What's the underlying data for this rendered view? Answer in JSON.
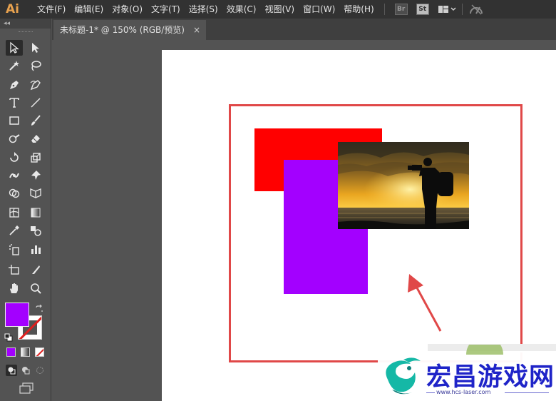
{
  "app": {
    "logo": "Ai"
  },
  "menubar": {
    "items": [
      {
        "label": "文件(F)"
      },
      {
        "label": "编辑(E)"
      },
      {
        "label": "对象(O)"
      },
      {
        "label": "文字(T)"
      },
      {
        "label": "选择(S)"
      },
      {
        "label": "效果(C)"
      },
      {
        "label": "视图(V)"
      },
      {
        "label": "窗口(W)"
      },
      {
        "label": "帮助(H)"
      }
    ],
    "bridge_label": "Br",
    "stock_label": "St"
  },
  "toolbox": {
    "collapse_label": "◂◂",
    "fill_color": "#a300ff",
    "stroke": "none"
  },
  "document_tab": {
    "title": "未标题-1* @ 150% (RGB/预览)",
    "close_label": "×"
  },
  "canvas": {
    "red_rect_color": "#ff0000",
    "purple_rect_color": "#a300ff",
    "highlight_color": "#e04848",
    "photo_subject": "photographer-silhouette-at-sunset"
  },
  "watermark": {
    "text": "宏昌游戏网",
    "url": "www.hcs-laser.com"
  }
}
